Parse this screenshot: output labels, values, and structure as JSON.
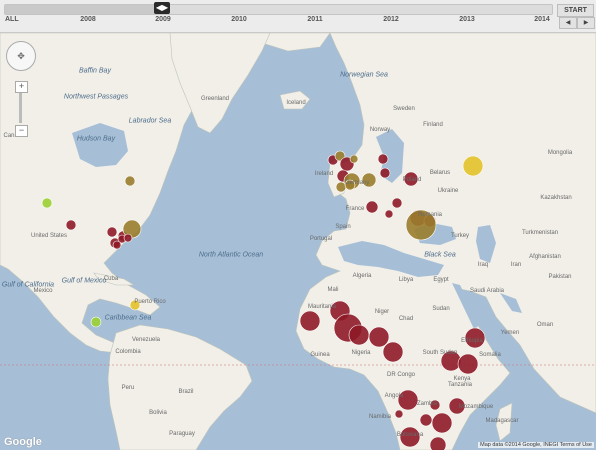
{
  "timeline": {
    "all_label": "ALL",
    "start_label": "START",
    "prev_icon": "◀",
    "next_icon": "▶",
    "handle_icon": "◀▶",
    "years": [
      "2008",
      "2009",
      "2010",
      "2011",
      "2012",
      "2013",
      "2014"
    ],
    "selected_year": "2009"
  },
  "map_controls": {
    "pan_icon": "✥",
    "zoom_in": "+",
    "zoom_out": "−"
  },
  "map": {
    "labels": [
      {
        "text": "Greenland",
        "kind": "cont"
      },
      {
        "text": "Iceland",
        "kind": "cont"
      },
      {
        "text": "Norwegian Sea",
        "kind": "ocean"
      },
      {
        "text": "Norway",
        "kind": "cont"
      },
      {
        "text": "Sweden",
        "kind": "cont"
      },
      {
        "text": "Finland",
        "kind": "cont"
      },
      {
        "text": "Canada",
        "kind": "cont"
      },
      {
        "text": "Hudson Bay",
        "kind": "ocean"
      },
      {
        "text": "Baffin Bay",
        "kind": "ocean"
      },
      {
        "text": "Northwest Passages",
        "kind": "ocean"
      },
      {
        "text": "Labrador Sea",
        "kind": "ocean"
      },
      {
        "text": "Ireland",
        "kind": "cont"
      },
      {
        "text": "Germany",
        "kind": "cont"
      },
      {
        "text": "Poland",
        "kind": "cont"
      },
      {
        "text": "Belarus",
        "kind": "cont"
      },
      {
        "text": "Ukraine",
        "kind": "cont"
      },
      {
        "text": "Kazakhstan",
        "kind": "cont"
      },
      {
        "text": "Mongolia",
        "kind": "cont"
      },
      {
        "text": "France",
        "kind": "cont"
      },
      {
        "text": "Spain",
        "kind": "cont"
      },
      {
        "text": "Portugal",
        "kind": "cont"
      },
      {
        "text": "Romania",
        "kind": "cont"
      },
      {
        "text": "Turkey",
        "kind": "cont"
      },
      {
        "text": "Black Sea",
        "kind": "ocean"
      },
      {
        "text": "Turkmenistan",
        "kind": "cont"
      },
      {
        "text": "Iran",
        "kind": "cont"
      },
      {
        "text": "Afghanistan",
        "kind": "cont"
      },
      {
        "text": "Pakistan",
        "kind": "cont"
      },
      {
        "text": "Iraq",
        "kind": "cont"
      },
      {
        "text": "United States",
        "kind": "cont"
      },
      {
        "text": "Mexico",
        "kind": "cont"
      },
      {
        "text": "Gulf of Mexico",
        "kind": "ocean"
      },
      {
        "text": "Gulf of California",
        "kind": "ocean"
      },
      {
        "text": "Cuba",
        "kind": "cont"
      },
      {
        "text": "Caribbean Sea",
        "kind": "ocean"
      },
      {
        "text": "Puerto Rico",
        "kind": "cont"
      },
      {
        "text": "North Atlantic Ocean",
        "kind": "ocean"
      },
      {
        "text": "Algeria",
        "kind": "cont"
      },
      {
        "text": "Libya",
        "kind": "cont"
      },
      {
        "text": "Egypt",
        "kind": "cont"
      },
      {
        "text": "Saudi Arabia",
        "kind": "cont"
      },
      {
        "text": "Mali",
        "kind": "cont"
      },
      {
        "text": "Mauritania",
        "kind": "cont"
      },
      {
        "text": "Niger",
        "kind": "cont"
      },
      {
        "text": "Chad",
        "kind": "cont"
      },
      {
        "text": "Sudan",
        "kind": "cont"
      },
      {
        "text": "Yemen",
        "kind": "cont"
      },
      {
        "text": "Oman",
        "kind": "cont"
      },
      {
        "text": "Nigeria",
        "kind": "cont"
      },
      {
        "text": "Guinea",
        "kind": "cont"
      },
      {
        "text": "Ethiopia",
        "kind": "cont"
      },
      {
        "text": "Somalia",
        "kind": "cont"
      },
      {
        "text": "South Sudan",
        "kind": "cont"
      },
      {
        "text": "Kenya",
        "kind": "cont"
      },
      {
        "text": "Tanzania",
        "kind": "cont"
      },
      {
        "text": "DR Congo",
        "kind": "cont"
      },
      {
        "text": "Angola",
        "kind": "cont"
      },
      {
        "text": "Zambia",
        "kind": "cont"
      },
      {
        "text": "Namibia",
        "kind": "cont"
      },
      {
        "text": "Botswana",
        "kind": "cont"
      },
      {
        "text": "Mozambique",
        "kind": "cont"
      },
      {
        "text": "Madagascar",
        "kind": "cont"
      },
      {
        "text": "Venezuela",
        "kind": "cont"
      },
      {
        "text": "Colombia",
        "kind": "cont"
      },
      {
        "text": "Peru",
        "kind": "cont"
      },
      {
        "text": "Brazil",
        "kind": "cont"
      },
      {
        "text": "Bolivia",
        "kind": "cont"
      },
      {
        "text": "Paraguay",
        "kind": "cont"
      }
    ],
    "google_logo": "Google",
    "attribution": "Map data ©2014 Google, INEGI   Terms of Use"
  },
  "colors": {
    "water": "#a6bfd7",
    "land": "#f1efe8",
    "dark_red": "#8e1a27",
    "olive": "#9a7d2e",
    "yellow": "#e3c22a",
    "lime": "#9bd034"
  }
}
